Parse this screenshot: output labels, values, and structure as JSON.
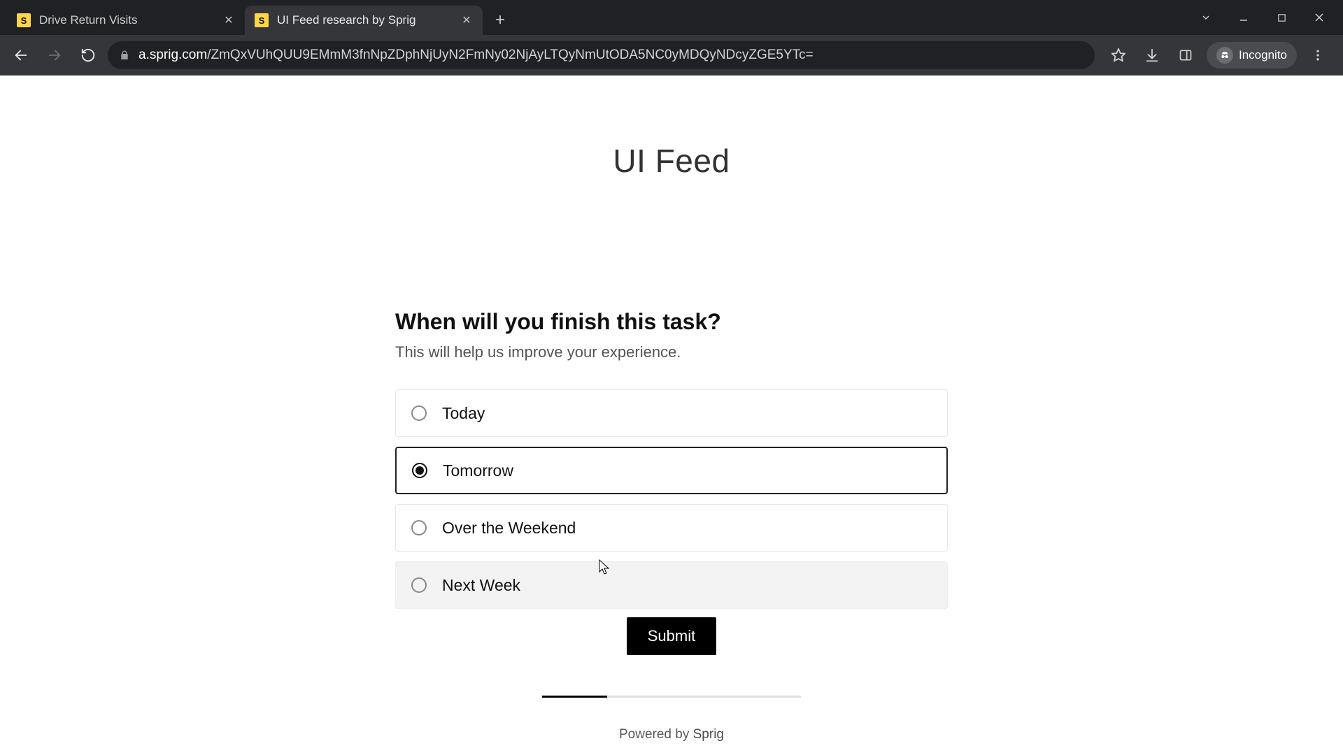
{
  "browser": {
    "tabs": [
      {
        "title": "Drive Return Visits",
        "active": false,
        "favicon_letter": "S"
      },
      {
        "title": "UI Feed research by Sprig",
        "active": true,
        "favicon_letter": "S"
      }
    ],
    "url_domain": "a.sprig.com",
    "url_path": "/ZmQxVUhQUU9EMmM3fnNpZDphNjUyN2FmNy02NjAyLTQyNmUtODA5NC0yMDQyNDcyZGE5YTc=",
    "incognito_label": "Incognito"
  },
  "page": {
    "brand": "UI Feed",
    "question": "When will you finish this task?",
    "helper": "This will help us improve your experience.",
    "options": [
      {
        "label": "Today",
        "selected": false,
        "hovered": false
      },
      {
        "label": "Tomorrow",
        "selected": true,
        "hovered": false
      },
      {
        "label": "Over the Weekend",
        "selected": false,
        "hovered": false
      },
      {
        "label": "Next Week",
        "selected": false,
        "hovered": true
      }
    ],
    "submit_label": "Submit",
    "progress_percent": 25,
    "powered_prefix": "Powered by ",
    "powered_brand": "Sprig"
  }
}
